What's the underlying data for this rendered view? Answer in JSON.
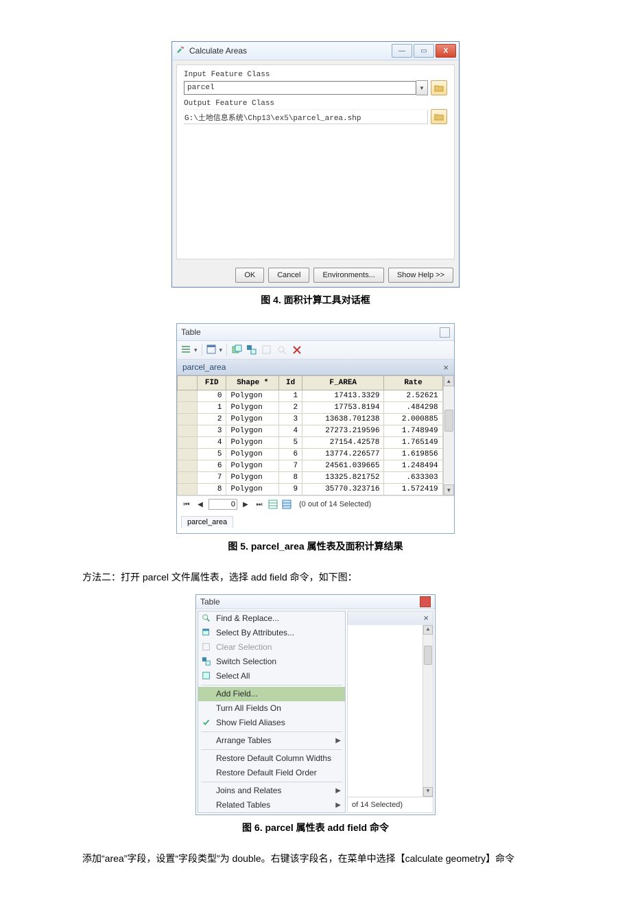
{
  "fig4": {
    "title": "Calculate Areas",
    "labels": {
      "input": "Input Feature Class",
      "output": "Output Feature Class"
    },
    "values": {
      "input": "parcel",
      "output": "G:\\土地信息系统\\Chp13\\ex5\\parcel_area.shp"
    },
    "buttons": {
      "ok": "OK",
      "cancel": "Cancel",
      "env": "Environments...",
      "help": "Show Help >>"
    },
    "caption": "图 4.  面积计算工具对话框"
  },
  "fig5": {
    "winTitle": "Table",
    "tabName": "parcel_area",
    "headers": [
      "FID",
      "Shape *",
      "Id",
      "F_AREA",
      "Rate"
    ],
    "rows": [
      [
        "0",
        "Polygon",
        "1",
        "17413.3329",
        "2.52621"
      ],
      [
        "1",
        "Polygon",
        "2",
        "17753.8194",
        ".484298"
      ],
      [
        "2",
        "Polygon",
        "3",
        "13638.701238",
        "2.000885"
      ],
      [
        "3",
        "Polygon",
        "4",
        "27273.219596",
        "1.748949"
      ],
      [
        "4",
        "Polygon",
        "5",
        "27154.42578",
        "1.765149"
      ],
      [
        "5",
        "Polygon",
        "6",
        "13774.226577",
        "1.619856"
      ],
      [
        "6",
        "Polygon",
        "7",
        "24561.039665",
        "1.248494"
      ],
      [
        "7",
        "Polygon",
        "8",
        "13325.821752",
        ".633303"
      ],
      [
        "8",
        "Polygon",
        "9",
        "35770.323716",
        "1.572419"
      ]
    ],
    "navValue": "0",
    "selText": "(0 out of 14 Selected)",
    "bottomTab": "parcel_area",
    "caption": "图 5. parcel_area 属性表及面积计算结果"
  },
  "method2": "方法二：打开 parcel 文件属性表，选择 add field 命令，如下图：",
  "fig6": {
    "winTitle": "Table",
    "menu": [
      {
        "icon": "find",
        "label": "Find & Replace..."
      },
      {
        "icon": "select-attr",
        "label": "Select By Attributes..."
      },
      {
        "icon": "clear",
        "label": "Clear Selection",
        "disabled": true
      },
      {
        "icon": "switch",
        "label": "Switch Selection"
      },
      {
        "icon": "select-all",
        "label": "Select All"
      },
      {
        "sep": true
      },
      {
        "icon": "",
        "label": "Add Field...",
        "hl": true
      },
      {
        "icon": "",
        "label": "Turn All Fields On"
      },
      {
        "icon": "check",
        "label": "Show Field Aliases"
      },
      {
        "sep": true
      },
      {
        "icon": "",
        "label": "Arrange Tables",
        "sub": true
      },
      {
        "sep": true
      },
      {
        "icon": "",
        "label": "Restore Default Column Widths"
      },
      {
        "icon": "",
        "label": "Restore Default Field Order"
      },
      {
        "sep": true
      },
      {
        "icon": "",
        "label": "Joins and Relates",
        "sub": true
      },
      {
        "icon": "",
        "label": "Related Tables",
        "sub": true
      }
    ],
    "status": "of 14 Selected)",
    "caption": "图 6. parcel 属性表 add field 命令"
  },
  "bodyAfter": "添加“area”字段，设置“字段类型”为 double。右键该字段名，在菜单中选择【calculate geometry】命令"
}
